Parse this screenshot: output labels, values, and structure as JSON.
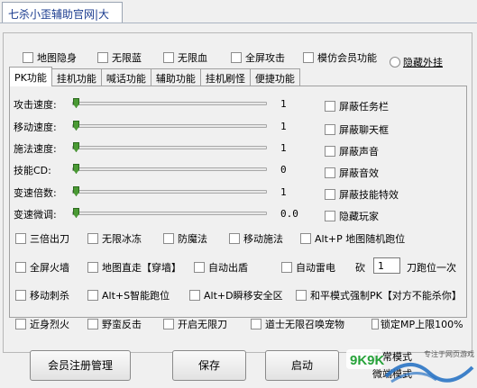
{
  "window": {
    "title": "七杀小歪辅助官网|大"
  },
  "top_options": [
    {
      "label": "地图隐身"
    },
    {
      "label": "无限蓝"
    },
    {
      "label": "无限血"
    },
    {
      "label": "全屏攻击"
    },
    {
      "label": "模仿会员功能"
    }
  ],
  "hide_plugin": {
    "label": "隐藏外挂"
  },
  "tabs": [
    {
      "label": "PK功能",
      "active": true
    },
    {
      "label": "挂机功能"
    },
    {
      "label": "喊话功能"
    },
    {
      "label": "辅助功能"
    },
    {
      "label": "挂机刷怪"
    },
    {
      "label": "便捷功能"
    }
  ],
  "sliders": [
    {
      "label": "攻击速度:",
      "value": "1",
      "level": 0
    },
    {
      "label": "移动速度:",
      "value": "1",
      "level": 0
    },
    {
      "label": "施法速度:",
      "value": "1",
      "level": 0
    },
    {
      "label": "技能CD:",
      "value": "0",
      "level": 0
    },
    {
      "label": "变速倍数:",
      "value": "1",
      "level": 0
    },
    {
      "label": "变速微调:",
      "value": "0.0",
      "level": 0
    }
  ],
  "right_options": [
    {
      "label": "屏蔽任务栏"
    },
    {
      "label": "屏蔽聊天框"
    },
    {
      "label": "屏蔽声音"
    },
    {
      "label": "屏蔽音效"
    },
    {
      "label": "屏蔽技能特效"
    },
    {
      "label": "隐藏玩家"
    }
  ],
  "option_rows": [
    [
      "三倍出刀",
      "无限冰冻",
      "防魔法",
      "移动施法",
      "Alt+P 地图随机跑位"
    ],
    [
      "全屏火墙",
      "地图直走【穿墙】",
      "自动出盾",
      "自动雷电"
    ],
    [
      "移动刺杀",
      "Alt+S智能跑位",
      "Alt+D瞬移安全区",
      "和平模式强制PK【对方不能杀你】"
    ],
    [
      "近身烈火",
      "野蛮反击",
      "开启无限刀",
      "道士无限召唤宠物",
      "锁定MP上限100%"
    ]
  ],
  "knife_run": {
    "prefix": "砍",
    "value": "1",
    "suffix": "刀跑位一次"
  },
  "buttons": {
    "member": "会员注册管理",
    "save": "保存",
    "start": "启动"
  },
  "bottom_modes": [
    "正常模式",
    "微端模式"
  ],
  "watermark": {
    "logo": "9K9K",
    "slogan": "专注于网页游戏"
  }
}
